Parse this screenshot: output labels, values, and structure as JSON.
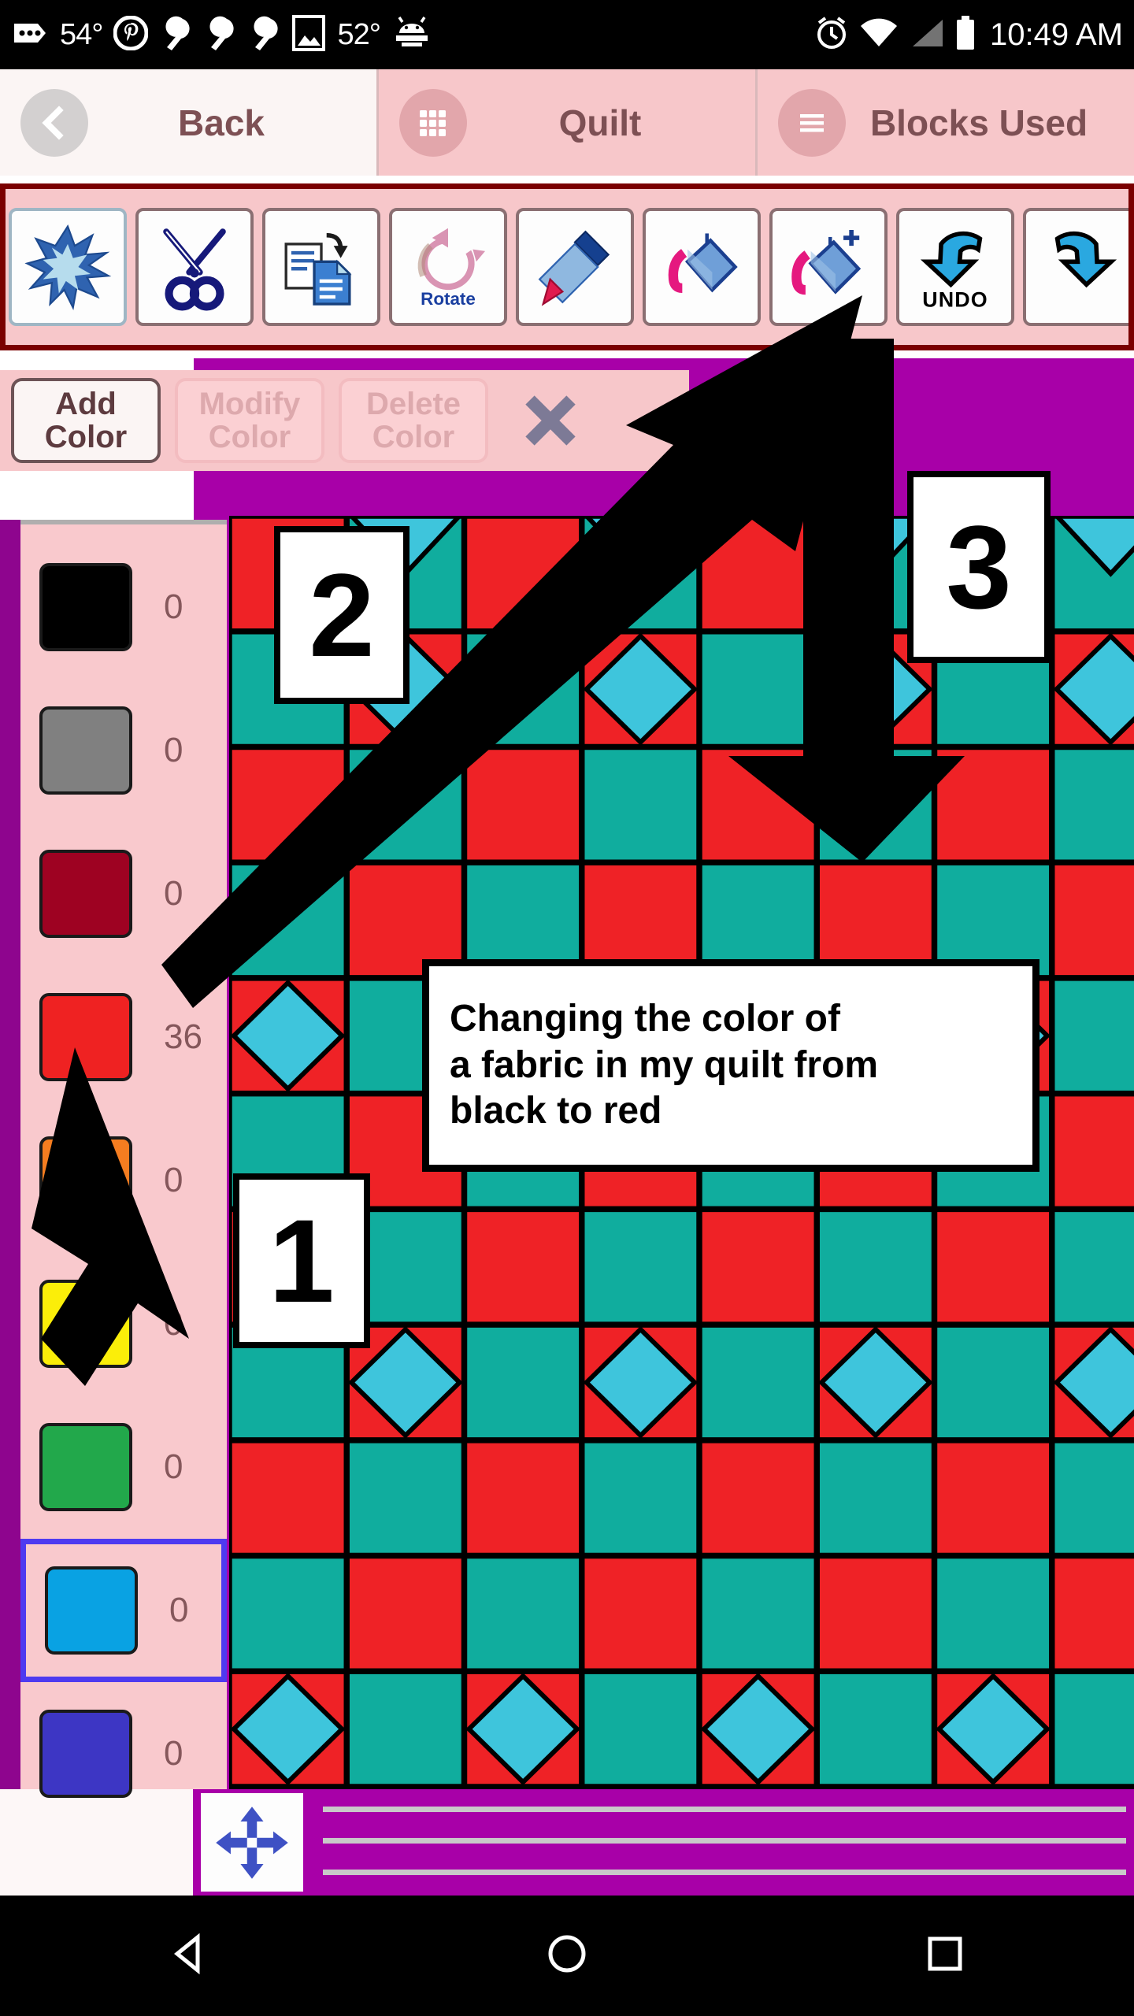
{
  "statusbar": {
    "icons_left": [
      "more-horizontal-icon",
      "pinterest-icon",
      "wrench-icon",
      "wrench-icon",
      "wrench-icon",
      "image-icon",
      "android-icon"
    ],
    "temp_1": "54°",
    "temp_2": "52°",
    "icons_right": [
      "alarm-icon",
      "wifi-icon",
      "signal-icon",
      "battery-icon"
    ],
    "clock": "10:49 AM"
  },
  "tabs": [
    {
      "label": "Back",
      "icon": "back-chevron-icon",
      "state": "light"
    },
    {
      "label": "Quilt",
      "icon": "grid-icon",
      "state": "pink"
    },
    {
      "label": "Blocks Used",
      "icon": "list-icon",
      "state": "pink"
    }
  ],
  "toolbar": {
    "buttons": [
      {
        "name": "new-block-button",
        "icon": "starburst-icon",
        "label": ""
      },
      {
        "name": "cut-button",
        "icon": "scissors-icon",
        "label": ""
      },
      {
        "name": "copy-button",
        "icon": "copy-paste-icon",
        "label": ""
      },
      {
        "name": "rotate-button",
        "icon": "rotate-icon",
        "label": "Rotate"
      },
      {
        "name": "eyedropper-button",
        "icon": "eyedropper-icon",
        "label": ""
      },
      {
        "name": "paint-bucket-button",
        "icon": "paint-bucket-icon",
        "label": ""
      },
      {
        "name": "paint-bucket-add-button",
        "icon": "paint-bucket-plus-icon",
        "label": ""
      },
      {
        "name": "undo-button",
        "icon": "undo-arrow-icon",
        "label": "UNDO"
      },
      {
        "name": "redo-button",
        "icon": "redo-arrow-icon",
        "label": ""
      }
    ]
  },
  "color_panel": {
    "add_label": "Add\nColor",
    "add_line1": "Add",
    "add_line2": "Color",
    "modify_line1": "Modify",
    "modify_line2": "Color",
    "delete_line1": "Delete",
    "delete_line2": "Color",
    "close_icon": "close-x-icon",
    "swatches": [
      {
        "color": "#000000",
        "count": "0",
        "selected": false
      },
      {
        "color": "#808080",
        "count": "0",
        "selected": false
      },
      {
        "color": "#9e0222",
        "count": "0",
        "selected": false
      },
      {
        "color": "#ef2222",
        "count": "36",
        "selected": false
      },
      {
        "color": "#f57d20",
        "count": "0",
        "selected": false
      },
      {
        "color": "#fbee09",
        "count": "0",
        "selected": false
      },
      {
        "color": "#22a84b",
        "count": "0",
        "selected": false
      },
      {
        "color": "#09a2e3",
        "count": "0",
        "selected": true
      },
      {
        "color": "#3d36c4",
        "count": "0",
        "selected": false
      }
    ]
  },
  "quilt": {
    "colors": {
      "red": "#ef2226",
      "teal": "#10ad9e",
      "cyan": "#3ec5dc",
      "line": "#000000"
    },
    "cols": 8,
    "rows": 11
  },
  "bottom": {
    "move_icon": "move-four-arrows-icon"
  },
  "navbar": {
    "items": [
      "back-triangle-icon",
      "home-circle-icon",
      "recents-square-icon"
    ]
  },
  "annotations": {
    "step1": "1",
    "step2": "2",
    "step3": "3",
    "callout_line1": "Changing the color of",
    "callout_line2": "a fabric in my quilt from",
    "callout_line3": "black to red",
    "callout_text": "Changing the color of a fabric in my quilt from black to red"
  }
}
